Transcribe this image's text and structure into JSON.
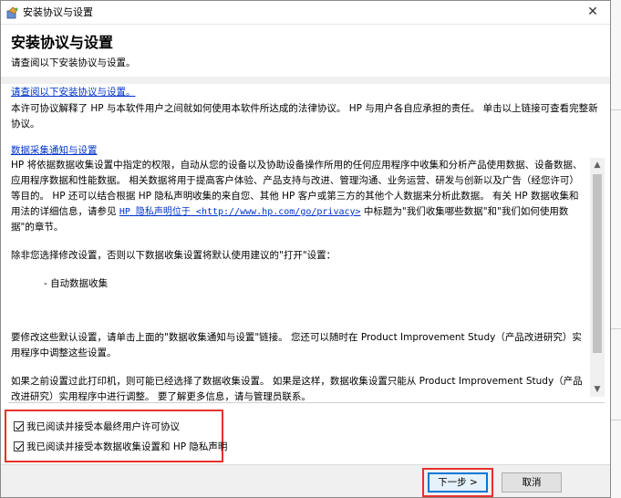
{
  "window": {
    "title": "安装协议与设置",
    "close_glyph": "✕"
  },
  "header": {
    "title": "安装协议与设置",
    "subtitle": "请查阅以下安装协议与设置。"
  },
  "content": {
    "link1": "请查阅以下安装协议与设置。",
    "para1": "本许可协议解释了 HP 与本软件用户之间就如何使用本软件所达成的法律协议。 HP 与用户各自应承担的责任。 单击以上链接可查看完整新协议。",
    "link2": "数据采集通知与设置",
    "scroll": {
      "para_a_1": "HP 将依据数据收集设置中指定的权限，自动从您的设备以及协助设备操作所用的任何应用程序中收集和分析产品使用数据、设备数据、应用程序数据和性能数据。 相关数据将用于提高客户体验、产品支持与改进、管理沟通、业务运营、研发与创新以及广告（经您许可）等目的。 HP 还可以结合根据 HP 隐私声明收集的来自您、其他 HP 客户或第三方的其他个人数据来分析此数据。 有关 HP 数据收集和用法的详细信息，请参见 ",
      "privacy_link": "HP 隐私声明位于 <http://www.hp.com/go/privacy>",
      "para_a_2": " 中标题为\"我们收集哪些数据\"和\"我们如何使用数据\"的章节。",
      "para_b": "除非您选择修改设置，否则以下数据收集设置将默认使用建议的\"打开\"设置：",
      "item": "- 自动数据收集",
      "para_c": "要修改这些默认设置，请单击上面的\"数据收集通知与设置\"链接。 您还可以随时在 Product Improvement Study（产品改进研究）实用程序中调整这些设置。",
      "para_d": "如果之前设置过此打印机，则可能已经选择了数据收集设置。 如果是这样，数据收集设置只能从 Product Improvement Study（产品改进研究）实用程序中进行调整。 要了解更多信息，请与管理员联系。"
    }
  },
  "checkboxes": [
    {
      "label": "我已阅读并接受本最终用户许可协议",
      "checked": true
    },
    {
      "label": "我已阅读并接受本数据收集设置和 HP 隐私声明",
      "checked": true
    }
  ],
  "footer": {
    "next_label": "下一步 >",
    "cancel_label": "取消"
  },
  "colors": {
    "highlight": "#e8302e",
    "link": "#0033cc",
    "accent": "#0078d7"
  },
  "icons": [
    "installer-icon",
    "close-icon",
    "scroll-up-icon",
    "scroll-down-icon",
    "checkmark-icon"
  ]
}
